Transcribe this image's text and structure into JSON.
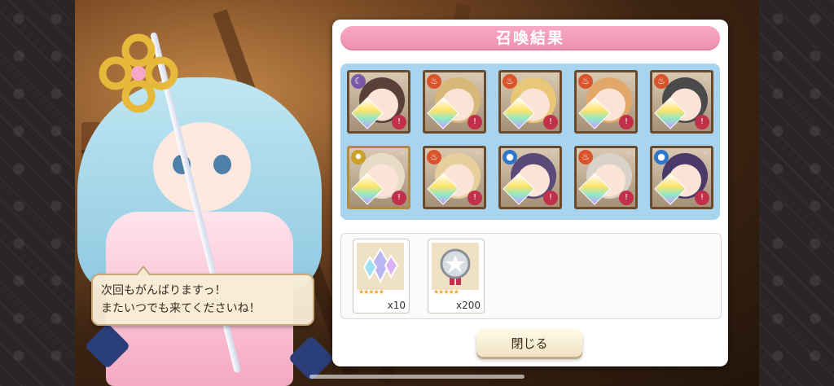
{
  "panel": {
    "title": "召喚結果",
    "close_label": "閉じる"
  },
  "speech": {
    "line1": "次回もがんばりますっ！",
    "line2": "またいつでも来てくださいね！"
  },
  "summon_results": [
    {
      "element": "moon",
      "element_color": "#7a5aa8",
      "rarity_gem": true
    },
    {
      "element": "fire",
      "element_color": "#d9542c",
      "rarity_gem": true
    },
    {
      "element": "fire",
      "element_color": "#d9542c",
      "rarity_gem": true
    },
    {
      "element": "fire",
      "element_color": "#d9542c",
      "rarity_gem": true
    },
    {
      "element": "fire",
      "element_color": "#d9542c",
      "rarity_gem": true
    },
    {
      "element": "sun",
      "element_color": "#c9a12a",
      "rarity_gem": true
    },
    {
      "element": "fire",
      "element_color": "#d9542c",
      "rarity_gem": true
    },
    {
      "element": "water",
      "element_color": "#2f76c8",
      "rarity_gem": true
    },
    {
      "element": "fire",
      "element_color": "#d9542c",
      "rarity_gem": true
    },
    {
      "element": "water",
      "element_color": "#2f76c8",
      "rarity_gem": true
    }
  ],
  "items": [
    {
      "icon": "crystal-icon",
      "stars": "★★★★★",
      "count": "x10"
    },
    {
      "icon": "medal-icon",
      "stars": "★★★★★",
      "count": "x200"
    }
  ],
  "colors": {
    "title_bar": "#ee8fb0",
    "grid_background": "#a9d4f0"
  }
}
